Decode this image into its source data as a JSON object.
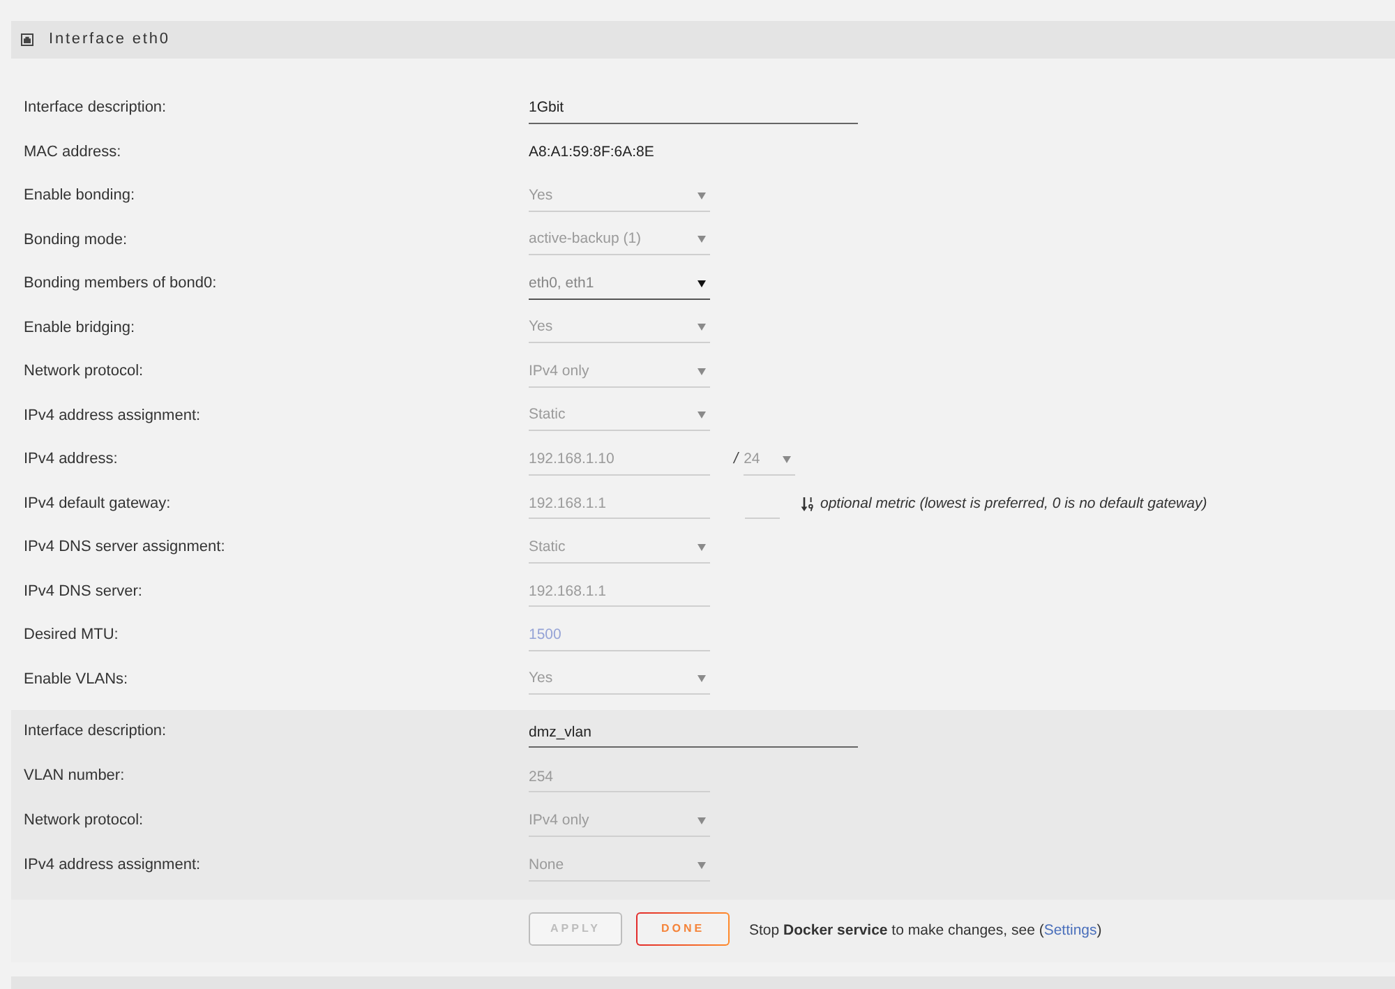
{
  "panel": {
    "title": "Interface eth0"
  },
  "rows": [
    {
      "label": "Interface description:",
      "fields": [
        {
          "kind": "text",
          "value": "1Gbit",
          "disabled": false
        }
      ]
    },
    {
      "label": "MAC address:",
      "fields": [
        {
          "kind": "static",
          "value": "A8:A1:59:8F:6A:8E"
        }
      ]
    },
    {
      "label": "Enable bonding:",
      "fields": [
        {
          "kind": "select",
          "value": "Yes",
          "disabled": true
        }
      ]
    },
    {
      "label": "Bonding mode:",
      "fields": [
        {
          "kind": "select",
          "value": "active-backup (1)",
          "disabled": true
        }
      ]
    },
    {
      "label": "Bonding members of bond0:",
      "fields": [
        {
          "kind": "select",
          "value": "eth0, eth1",
          "disabled": false
        }
      ]
    },
    {
      "label": "Enable bridging:",
      "fields": [
        {
          "kind": "select",
          "value": "Yes",
          "disabled": true
        }
      ]
    },
    {
      "label": "Network protocol:",
      "fields": [
        {
          "kind": "select",
          "value": "IPv4 only",
          "disabled": true
        }
      ]
    },
    {
      "label": "IPv4 address assignment:",
      "fields": [
        {
          "kind": "select",
          "value": "Static",
          "disabled": true
        }
      ]
    },
    {
      "label": "IPv4 address:",
      "fields": [
        {
          "kind": "input",
          "value": "192.168.1.10",
          "disabled": true
        },
        {
          "kind": "separator",
          "text": "/"
        },
        {
          "kind": "prefix",
          "value": "24",
          "disabled": true
        }
      ]
    },
    {
      "label": "IPv4 default gateway:",
      "fields": [
        {
          "kind": "input",
          "value": "192.168.1.1",
          "disabled": true
        },
        {
          "kind": "metric",
          "disabled": true
        },
        {
          "kind": "hint",
          "text": "optional metric (lowest is preferred, 0 is no default gateway)"
        }
      ]
    },
    {
      "label": "IPv4 DNS server assignment:",
      "fields": [
        {
          "kind": "select",
          "value": "Static",
          "disabled": true
        }
      ]
    },
    {
      "label": "IPv4 DNS server:",
      "fields": [
        {
          "kind": "input",
          "value": "192.168.1.1",
          "disabled": true
        }
      ]
    },
    {
      "label": "Desired MTU:",
      "fields": [
        {
          "kind": "input",
          "placeholder": "1500",
          "disabled": true
        }
      ]
    },
    {
      "label": "Enable VLANs:",
      "fields": [
        {
          "kind": "select",
          "value": "Yes",
          "disabled": true
        }
      ]
    }
  ],
  "vlan_rows": [
    {
      "label": "Interface description:",
      "fields": [
        {
          "kind": "text",
          "value": "dmz_vlan",
          "disabled": false
        }
      ]
    },
    {
      "label": "VLAN number:",
      "fields": [
        {
          "kind": "input",
          "value": "254",
          "disabled": true
        }
      ]
    },
    {
      "label": "Network protocol:",
      "fields": [
        {
          "kind": "select",
          "value": "IPv4 only",
          "disabled": true
        }
      ]
    },
    {
      "label": "IPv4 address assignment:",
      "fields": [
        {
          "kind": "select",
          "value": "None",
          "disabled": true
        }
      ]
    }
  ],
  "actions": {
    "buttons": [
      {
        "kind": "apply",
        "label": "APPLY",
        "disabled": true
      },
      {
        "kind": "done",
        "label": "DONE",
        "disabled": false
      }
    ],
    "notice": {
      "text": "Stop **Docker service** to make changes, see (",
      "link": "Settings",
      "text_after": ")"
    }
  }
}
